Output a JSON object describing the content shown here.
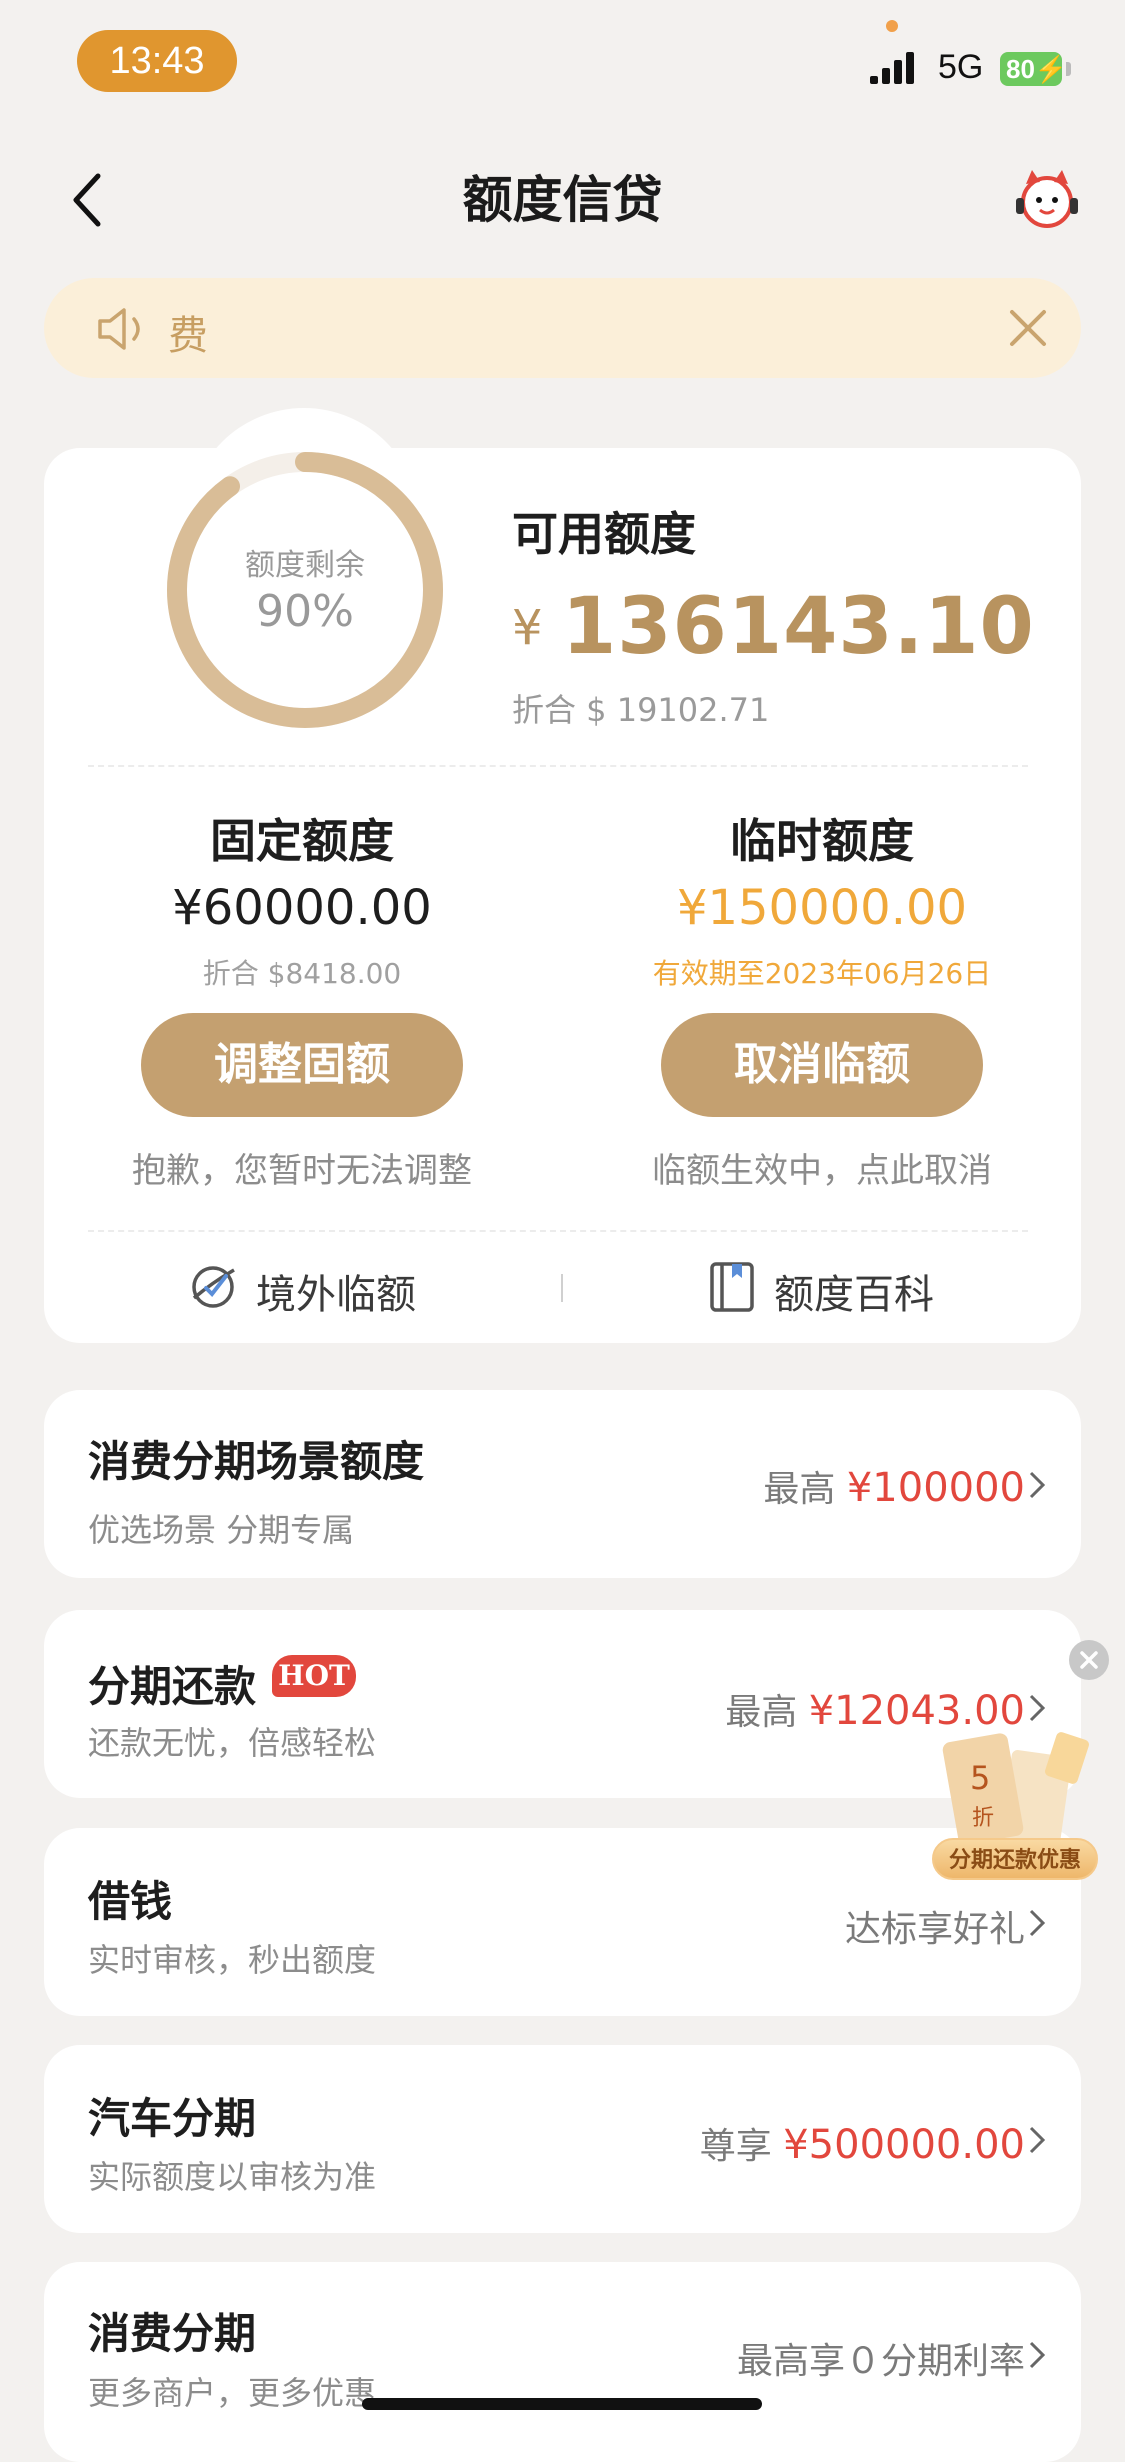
{
  "status_bar": {
    "time": "13:43",
    "network": "5G",
    "battery": "80"
  },
  "nav": {
    "title": "额度信贷",
    "icons": {
      "back": "chevron-left-icon",
      "service": "mascot-icon"
    }
  },
  "notice": {
    "text": "费",
    "icons": [
      "speaker-icon",
      "close-icon"
    ]
  },
  "credit": {
    "ring_label": "额度剩余",
    "ring_percent": "90%",
    "ring_fraction": 0.9,
    "available_title": "可用额度",
    "currency_symbol": "¥",
    "available_amount": "136143.10",
    "available_usd": "折合 $ 19102.71",
    "fixed": {
      "title": "固定额度",
      "amount": "¥60000.00",
      "usd": "折合 $8418.00",
      "button": "调整固额",
      "note": "抱歉，您暂时无法调整"
    },
    "temporary": {
      "title": "临时额度",
      "amount": "¥150000.00",
      "validity": "有效期至2023年06月26日",
      "button": "取消临额",
      "note": "临额生效中，点此取消"
    },
    "links": {
      "overseas": "境外临额",
      "encyclopedia": "额度百科"
    }
  },
  "items": [
    {
      "title": "消费分期场景额度",
      "subtitle": "优选场景 分期专属",
      "right_prefix": "最高",
      "right_value": "¥100000"
    },
    {
      "title": "分期还款",
      "badge": "HOT",
      "subtitle": "还款无忧，倍感轻松",
      "right_prefix": "最高",
      "right_value": "¥12043.00"
    },
    {
      "title": "借钱",
      "subtitle": "实时审核，秒出额度",
      "right_prefix": "达标享好礼",
      "right_value": ""
    },
    {
      "title": "汽车分期",
      "subtitle": "实际额度以审核为准",
      "right_prefix": "尊享",
      "right_value": "¥500000.00"
    },
    {
      "title": "消费分期",
      "subtitle": "更多商户，更多优惠",
      "right_prefix": "最高享０分期利率",
      "right_value": ""
    }
  ],
  "promo": {
    "label": "分期还款优惠",
    "discount_number": "5",
    "discount_unit": "折"
  },
  "colors": {
    "accent": "#c4a070",
    "amount": "#b8935f",
    "temp_amount": "#f0a83a",
    "red": "#e2473d"
  }
}
